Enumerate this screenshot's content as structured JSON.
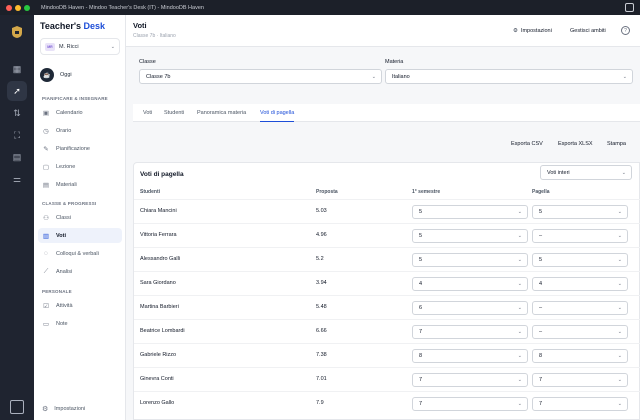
{
  "window": {
    "title": "MindooDB Haven - Mindoo Teacher's Desk (IT) - MindooDB Haven"
  },
  "brand": {
    "part1": "Teacher's ",
    "part2": "Desk"
  },
  "user": {
    "initials": "MR",
    "name": "M. Ricci"
  },
  "today": {
    "label": "Oggi"
  },
  "sections": {
    "plan": "PIANIFICARE & INSEGNARE",
    "class": "CLASSE & PROGRESSI",
    "personal": "PERSONALE"
  },
  "nav": {
    "calendario": "Calendario",
    "orario": "Orario",
    "pianificazione": "Pianificazione",
    "lezione": "Lezione",
    "materiali": "Materiali",
    "classi": "Classi",
    "voti": "Voti",
    "colloqui": "Colloqui & verbali",
    "analisi": "Analisi",
    "attivita": "Attività",
    "note": "Note",
    "impostazioni": "Impostazioni"
  },
  "header": {
    "title": "Voti",
    "subtitle": "Classe 7b · Italiano",
    "settings_btn": "Impostazioni",
    "manage_btn": "Gestisci ambiti",
    "help": "?"
  },
  "filters": {
    "class_label": "Classe",
    "class_value": "Classe 7b",
    "subject_label": "Materia",
    "subject_value": "Italiano"
  },
  "tabs": [
    "Voti",
    "Studenti",
    "Panoramica materia",
    "Voti di pagella"
  ],
  "export": {
    "csv": "Esporta CSV",
    "xlsx": "Esporta XLSX",
    "print": "Stampa"
  },
  "card": {
    "title": "Voti di pagella",
    "filter_value": "Voti interi",
    "columns": [
      "Studenti",
      "Proposta",
      "1° semestre",
      "Pagella"
    ],
    "rows": [
      {
        "name": "Chiara Mancini",
        "proposal": "5.03",
        "semester": "5",
        "report": "5"
      },
      {
        "name": "Vittoria Ferrara",
        "proposal": "4.96",
        "semester": "5",
        "report": "–"
      },
      {
        "name": "Alessandro Galli",
        "proposal": "5.2",
        "semester": "5",
        "report": "5"
      },
      {
        "name": "Sara Giordano",
        "proposal": "3.94",
        "semester": "4",
        "report": "4"
      },
      {
        "name": "Martina Barbieri",
        "proposal": "5.48",
        "semester": "6",
        "report": "–"
      },
      {
        "name": "Beatrice Lombardi",
        "proposal": "6.66",
        "semester": "7",
        "report": "–"
      },
      {
        "name": "Gabriele Rizzo",
        "proposal": "7.38",
        "semester": "8",
        "report": "8"
      },
      {
        "name": "Ginevra Conti",
        "proposal": "7.01",
        "semester": "7",
        "report": "7"
      },
      {
        "name": "Lorenzo Gallo",
        "proposal": "7.9",
        "semester": "7",
        "report": "7"
      }
    ]
  },
  "colors": {
    "accent": "#1d4ed8",
    "rail": "#1f2430"
  }
}
